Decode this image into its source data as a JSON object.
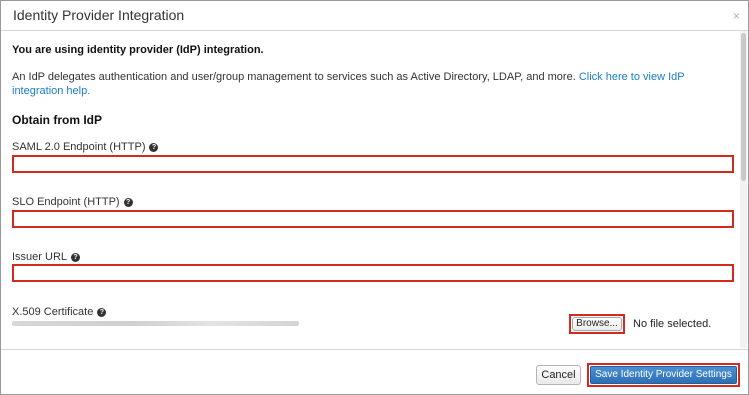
{
  "dialog": {
    "title": "Identity Provider Integration",
    "close_glyph": "×",
    "close_icon": "close-icon"
  },
  "intro": {
    "heading": "You are using identity provider (IdP) integration.",
    "description": "An IdP delegates authentication and user/group management to services such as Active Directory, LDAP, and more. ",
    "link_text": "Click here to view IdP integration help."
  },
  "section": {
    "title": "Obtain from IdP"
  },
  "fields": {
    "saml_label": "SAML 2.0 Endpoint (HTTP)",
    "saml_value": "",
    "slo_label": "SLO Endpoint (HTTP)",
    "slo_value": "",
    "issuer_label": "Issuer URL",
    "issuer_value": "",
    "cert_label": "X.509 Certificate",
    "help_glyph": "?"
  },
  "file": {
    "browse_label": "Browse...",
    "status": "No file selected."
  },
  "footer": {
    "cancel_label": "Cancel",
    "save_label": "Save Identity Provider Settings"
  },
  "colors": {
    "highlight": "#d22a1e",
    "link": "#1a7ec2",
    "primary_button": "#2d6fb5"
  }
}
